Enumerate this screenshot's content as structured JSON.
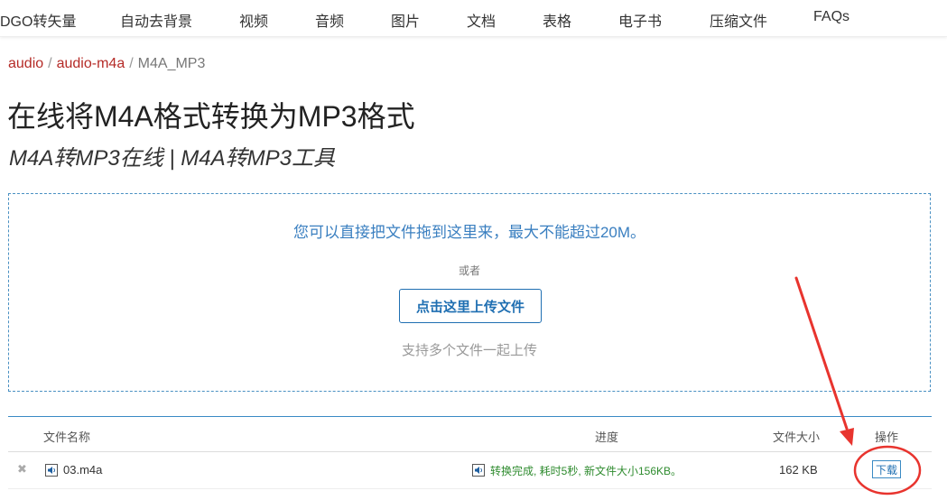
{
  "nav": {
    "items": [
      {
        "label": "DGO转矢量"
      },
      {
        "label": "自动去背景"
      },
      {
        "label": "视频"
      },
      {
        "label": "音频"
      },
      {
        "label": "图片"
      },
      {
        "label": "文档"
      },
      {
        "label": "表格"
      },
      {
        "label": "电子书"
      },
      {
        "label": "压缩文件"
      },
      {
        "label": "FAQs"
      }
    ]
  },
  "breadcrumb": {
    "items": [
      "audio",
      "audio-m4a"
    ],
    "separator": "/",
    "current": "M4A_MP3"
  },
  "page": {
    "title": "在线将M4A格式转换为MP3格式",
    "subtitle": "M4A转MP3在线 | M4A转MP3工具"
  },
  "dropzone": {
    "hint": "您可以直接把文件拖到这里来，最大不能超过20M。",
    "or": "或者",
    "upload_label": "点击这里上传文件",
    "multi_hint": "支持多个文件一起上传"
  },
  "table": {
    "headers": {
      "name": "文件名称",
      "progress": "进度",
      "size": "文件大小",
      "action": "操作"
    },
    "rows": [
      {
        "remove": "✖",
        "filename": "03.m4a",
        "status": "转换完成, 耗时5秒, 新文件大小156KB。",
        "size": "162 KB",
        "action_label": "下载"
      }
    ]
  },
  "colors": {
    "accent": "#1f6fb2",
    "link": "#b52b27",
    "annotation": "#e8342e",
    "success": "#2e8b2e"
  }
}
